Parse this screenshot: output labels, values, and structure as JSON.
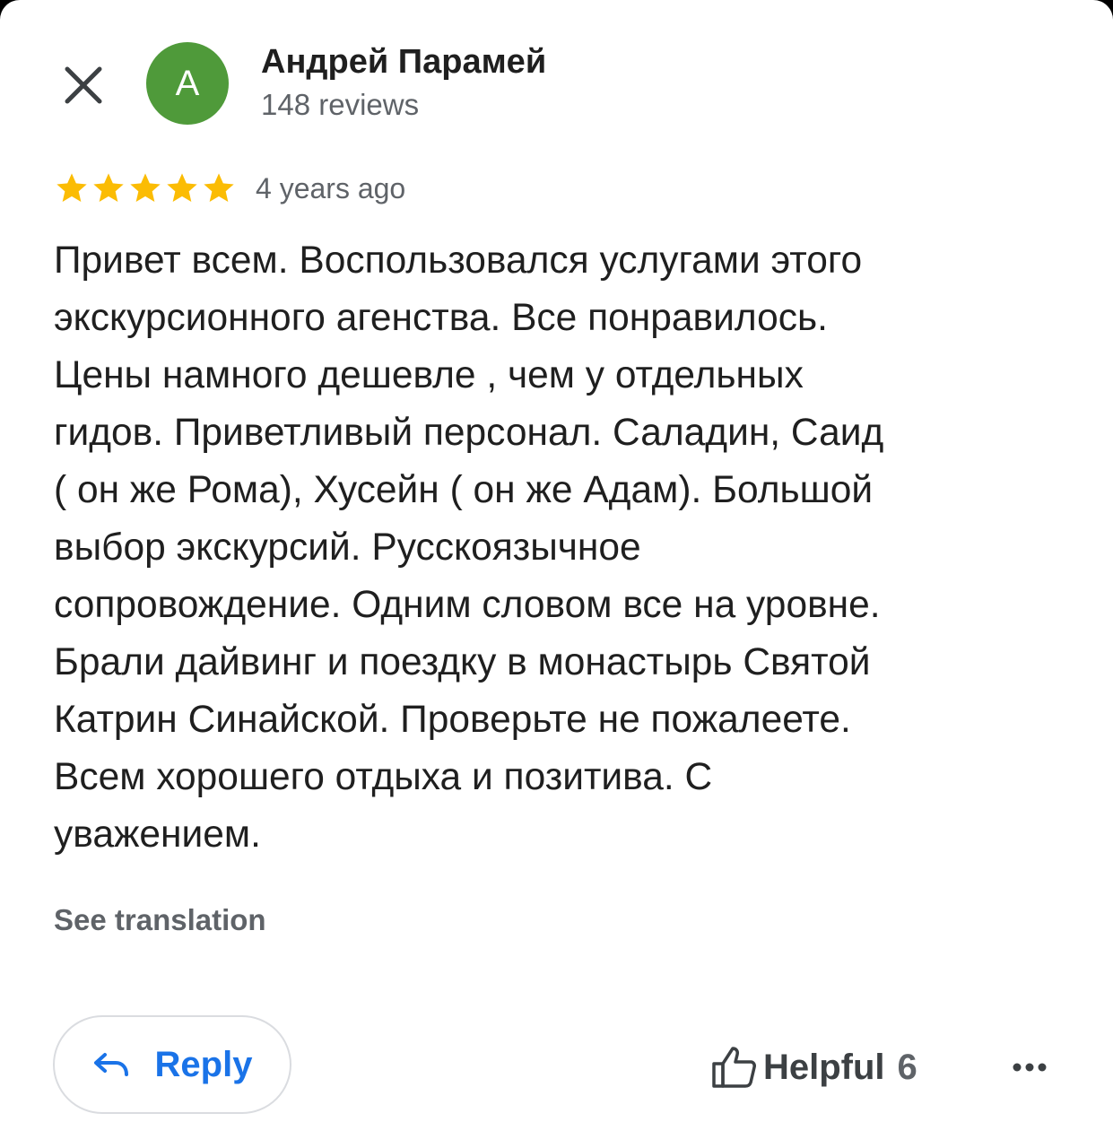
{
  "header": {
    "close_icon": "close-icon",
    "avatar_letter": "А",
    "avatar_color": "#4f9a3a",
    "author_name": "Андрей Парамей",
    "review_count": "148 reviews"
  },
  "rating": {
    "stars": 5,
    "max_stars": 5,
    "star_color": "#fbbc04",
    "time_ago": "4 years ago"
  },
  "review": {
    "lines": [
      "Привет всем. Воспользовался услугами этого",
      "экскурсионного агенства. Все понравилось.",
      "Цены намного дешевле , чем у отдельных",
      "гидов. Приветливый персонал. Саладин, Саид",
      "( он же Рома), Хусейн ( он же Адам). Большой",
      "выбор экскурсий. Русскоязычное",
      "сопровождение. Одним словом все на уровне.",
      "Брали дайвинг и поездку в монастырь Святой",
      "Катрин Синайской. Проверьте не пожалеете.",
      "Всем хорошего отдыха и позитива. С",
      "уважением."
    ],
    "see_translation": "See translation"
  },
  "actions": {
    "reply_label": "Reply",
    "reply_icon": "reply-arrow-icon",
    "helpful_label": "Helpful",
    "helpful_count": "6",
    "helpful_icon": "thumbs-up-icon",
    "more_icon": "more-horizontal-icon",
    "accent_color": "#1a73e8"
  }
}
